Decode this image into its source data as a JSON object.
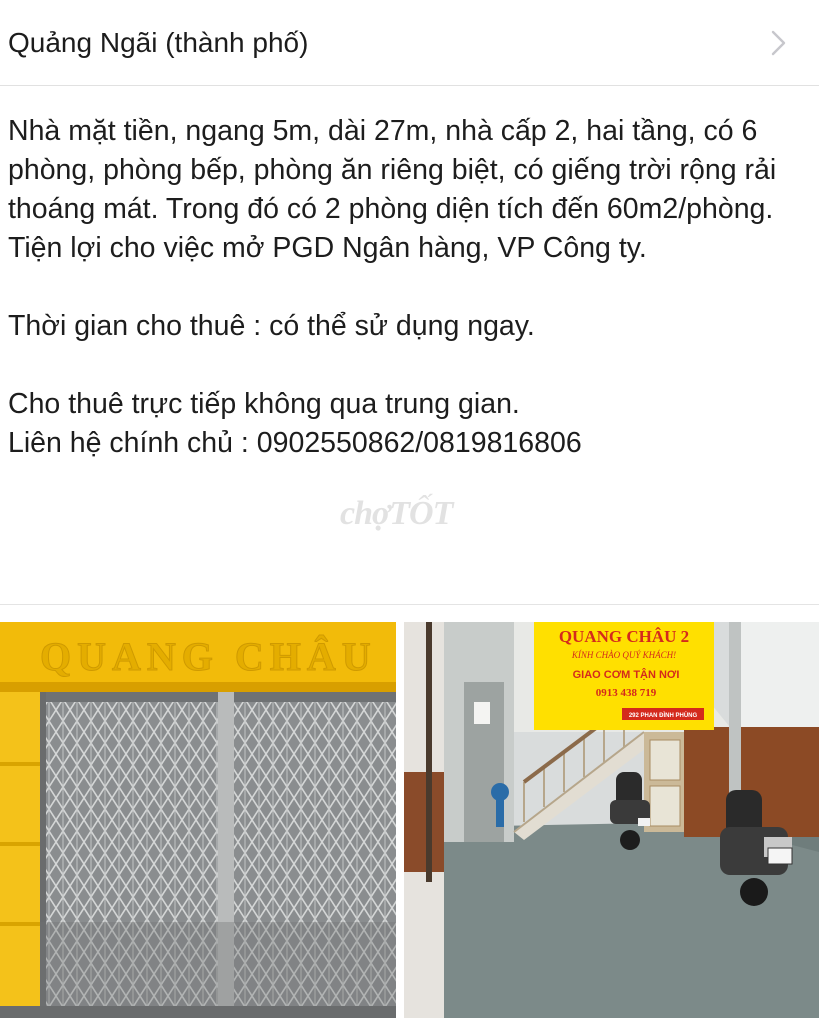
{
  "location": {
    "label": "Quảng Ngãi (thành phố)",
    "chevron_icon": "chevron-right-icon"
  },
  "description": {
    "paragraph1": "Nhà mặt tiền, ngang 5m, dài 27m, nhà cấp 2, hai tầng, có 6 phòng, phòng bếp, phòng ăn riêng biệt, có giếng trời rộng rải thoáng mát. Trong đó có 2 phòng diện tích đến 60m2/phòng. Tiện lợi cho việc mở PGD Ngân hàng, VP Công ty.",
    "paragraph2": "Thời gian cho thuê : có thể sử dụng ngay.",
    "paragraph3_line1": "Cho thuê trực tiếp không qua trung gian.",
    "paragraph3_line2": "Liên hệ chính chủ : 0902550862/0819816806"
  },
  "watermark": "chợTỐT",
  "photos": [
    {
      "name": "storefront-photo",
      "sign_text": "QUANG CHÂU"
    },
    {
      "name": "interior-photo",
      "sign": {
        "line1": "QUANG CHÂU 2",
        "line2": "KÍNH CHÀO QUÝ KHÁCH!",
        "line3": "GIAO CƠM TẬN NƠI",
        "line4": "0913 438 719",
        "line5": "292 PHAN ĐÌNH PHÙNG"
      }
    }
  ],
  "colors": {
    "text": "#1d1d1d",
    "divider": "#e1e1e1",
    "chevron": "#c7c7cc",
    "storefront_yellow": "#f0b800",
    "sign_yellow": "#ffe000",
    "sign_red": "#d42a1c"
  }
}
